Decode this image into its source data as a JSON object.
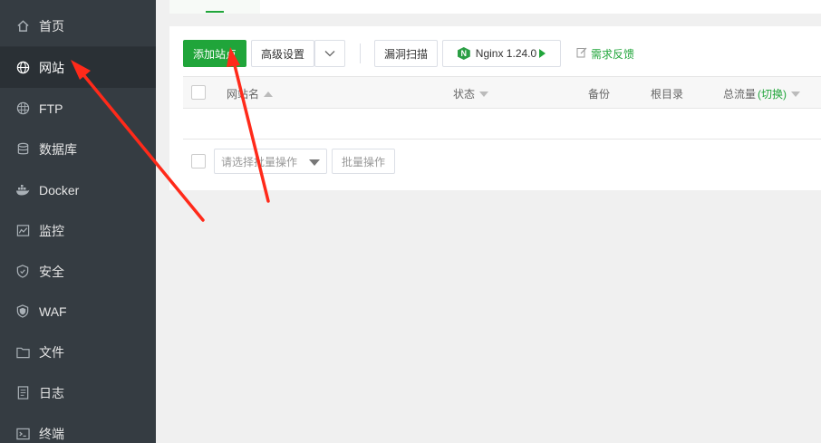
{
  "sidebar": {
    "items": [
      {
        "label": "首页",
        "icon": "home-icon",
        "active": false
      },
      {
        "label": "网站",
        "icon": "globe-icon",
        "active": true
      },
      {
        "label": "FTP",
        "icon": "ftp-globe-icon",
        "active": false
      },
      {
        "label": "数据库",
        "icon": "database-icon",
        "active": false
      },
      {
        "label": "Docker",
        "icon": "docker-icon",
        "active": false
      },
      {
        "label": "监控",
        "icon": "monitor-icon",
        "active": false
      },
      {
        "label": "安全",
        "icon": "shield-icon",
        "active": false
      },
      {
        "label": "WAF",
        "icon": "waf-shield-icon",
        "active": false
      },
      {
        "label": "文件",
        "icon": "folder-icon",
        "active": false
      },
      {
        "label": "日志",
        "icon": "log-icon",
        "active": false
      },
      {
        "label": "终端",
        "icon": "terminal-icon",
        "active": false
      }
    ]
  },
  "toolbar": {
    "add_site": "添加站点",
    "advanced": "高级设置",
    "scan": "漏洞扫描",
    "nginx": "Nginx 1.24.0",
    "feedback": "需求反馈"
  },
  "table": {
    "headers": {
      "name": "网站名",
      "status": "状态",
      "backup": "备份",
      "root": "根目录",
      "traffic": "总流量",
      "traffic_toggle": "(切换)"
    },
    "rows": []
  },
  "batch": {
    "placeholder": "请选择批量操作",
    "button": "批量操作"
  },
  "colors": {
    "accent": "#20a53a",
    "sidebar_bg": "#353c42",
    "annotation": "#ff2a1a"
  }
}
